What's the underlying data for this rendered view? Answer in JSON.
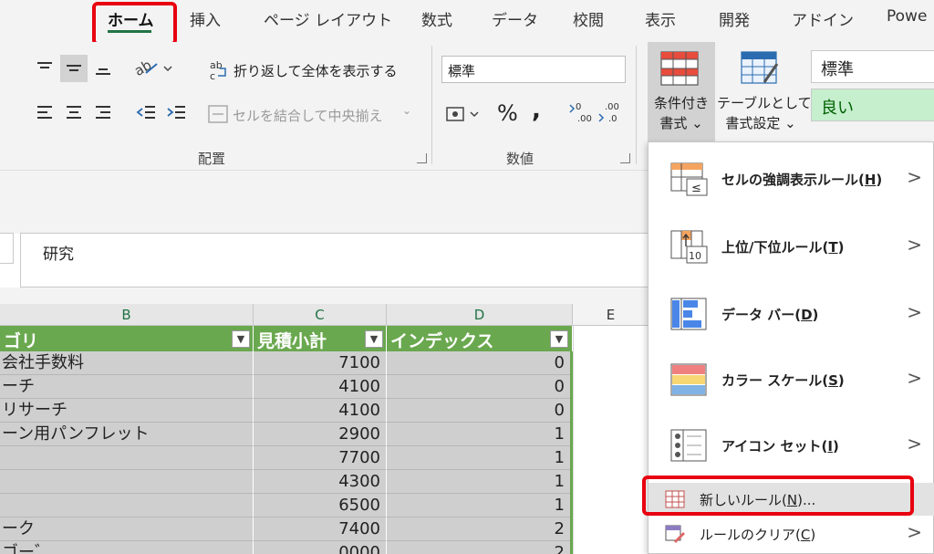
{
  "tabs": [
    {
      "label": "ホーム",
      "active": true
    },
    {
      "label": "挿入"
    },
    {
      "label": "ページ レイアウト"
    },
    {
      "label": "数式"
    },
    {
      "label": "データ"
    },
    {
      "label": "校閲"
    },
    {
      "label": "表示"
    },
    {
      "label": "開発"
    },
    {
      "label": "アドイン"
    },
    {
      "label": "Powe"
    }
  ],
  "ribbon": {
    "wrap_text": "折り返して全体を表示する",
    "merge_center": "セルを結合して中央揃え",
    "alignment_group": "配置",
    "number_format": "標準",
    "number_group": "数値",
    "cond_format_line1": "条件付き",
    "cond_format_line2": "書式",
    "table_format_line1": "テーブルとして",
    "table_format_line2": "書式設定",
    "style_normal": "標準",
    "style_good": "良い",
    "style_good_bg": "#c6efce",
    "style_good_color": "#006100"
  },
  "formula_bar": {
    "value": "研究"
  },
  "grid": {
    "columns": [
      "B",
      "C",
      "D",
      "E"
    ],
    "table_headers": [
      "ゴリ",
      "見積小計",
      "インデックス"
    ],
    "rows": [
      {
        "b": "会社手数料",
        "c": "7100",
        "d": "0"
      },
      {
        "b": "ーチ",
        "c": "4100",
        "d": "0"
      },
      {
        "b": "リサーチ",
        "c": "4100",
        "d": "0"
      },
      {
        "b": "ーン用パンフレット",
        "c": "2900",
        "d": "1"
      },
      {
        "b": "",
        "c": "7700",
        "d": "1"
      },
      {
        "b": "",
        "c": "4300",
        "d": "1"
      },
      {
        "b": "",
        "c": "6500",
        "d": "1"
      },
      {
        "b": "ーク",
        "c": "7400",
        "d": "2"
      },
      {
        "b": "ゴー゛",
        "c": "0000",
        "d": "2"
      }
    ],
    "header_color": "#6aa84f",
    "cell_color": "#cfcfcf"
  },
  "menu": {
    "items": [
      {
        "label": "セルの強調表示ルール(",
        "key": "H",
        "end": ")",
        "icon": "highlight-cells-rules-icon"
      },
      {
        "label": "上位/下位ルール(",
        "key": "T",
        "end": ")",
        "icon": "top-bottom-rules-icon"
      },
      {
        "label": "データ バー(",
        "key": "D",
        "end": ")",
        "icon": "data-bars-icon"
      },
      {
        "label": "カラー スケール(",
        "key": "S",
        "end": ")",
        "icon": "color-scales-icon"
      },
      {
        "label": "アイコン セット(",
        "key": "I",
        "end": ")",
        "icon": "icon-sets-icon"
      }
    ],
    "new_rule": {
      "label": "新しいルール(",
      "key": "N",
      "end": ")..."
    },
    "clear_rules": {
      "label": "ルールのクリア(",
      "key": "C",
      "end": ")"
    },
    "arrow": ">"
  },
  "highlight_color": "#e8000f"
}
